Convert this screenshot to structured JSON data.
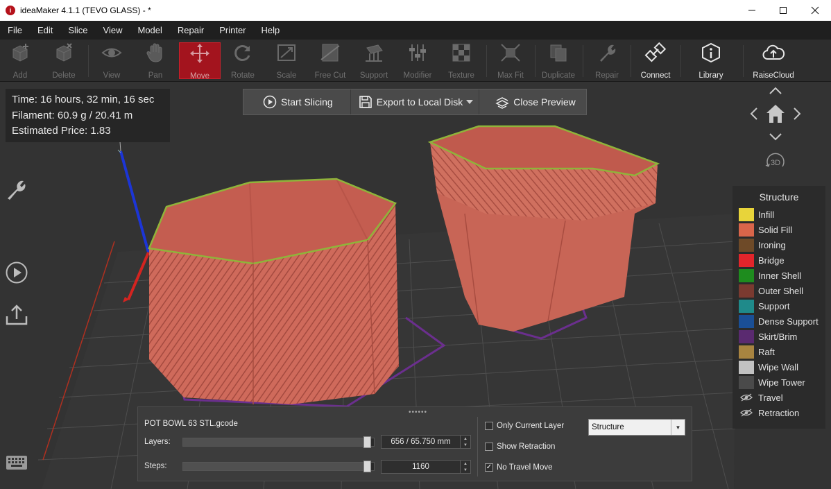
{
  "window": {
    "title": "ideaMaker 4.1.1 (TEVO GLASS) - *",
    "app_icon_glyph": "i"
  },
  "menu": [
    "File",
    "Edit",
    "Slice",
    "View",
    "Model",
    "Repair",
    "Printer",
    "Help"
  ],
  "toolbar": {
    "add": "Add",
    "delete": "Delete",
    "view": "View",
    "pan": "Pan",
    "move": "Move",
    "rotate": "Rotate",
    "scale": "Scale",
    "free_cut": "Free Cut",
    "support": "Support",
    "modifier": "Modifier",
    "texture": "Texture",
    "max_fit": "Max Fit",
    "duplicate": "Duplicate",
    "repair": "Repair",
    "connect": "Connect",
    "library": "Library",
    "raisecloud": "RaiseCloud",
    "active_tool": "move",
    "active_color": "#a3141e"
  },
  "info": {
    "time": "Time: 16 hours, 32 min, 16 sec",
    "filament": "Filament: 60.9 g / 20.41 m",
    "price": "Estimated Price: 1.83"
  },
  "actions": {
    "start_slicing": "Start Slicing",
    "export": "Export to Local Disk",
    "close_preview": "Close Preview"
  },
  "navpad": {
    "three_d": "3D"
  },
  "legend": {
    "title": "Structure",
    "items": [
      {
        "label": "Infill",
        "color": "#e8d43a"
      },
      {
        "label": "Solid Fill",
        "color": "#d9654a"
      },
      {
        "label": "Ironing",
        "color": "#6e4a28"
      },
      {
        "label": "Bridge",
        "color": "#e3252b"
      },
      {
        "label": "Inner Shell",
        "color": "#1e8c1e"
      },
      {
        "label": "Outer Shell",
        "color": "#7a3a30"
      },
      {
        "label": "Support",
        "color": "#1f8a8a"
      },
      {
        "label": "Dense Support",
        "color": "#1a4f96"
      },
      {
        "label": "Skirt/Brim",
        "color": "#5a2a70"
      },
      {
        "label": "Raft",
        "color": "#a88440"
      },
      {
        "label": "Wipe Wall",
        "color": "#c2c2c2"
      },
      {
        "label": "Wipe Tower",
        "color": "#4a4a4a"
      }
    ],
    "hidden_items": [
      {
        "label": "Travel",
        "icon": "eye-hidden-icon"
      },
      {
        "label": "Retraction",
        "icon": "eye-hidden-icon"
      }
    ]
  },
  "panel": {
    "filename": "POT BOWL 63 STL.gcode",
    "layers_label": "Layers:",
    "layers_value": "656 / 65.750 mm",
    "layers_fraction": 0.985,
    "steps_label": "Steps:",
    "steps_value": "1160",
    "steps_fraction": 0.985,
    "only_current_layer": {
      "label": "Only Current Layer",
      "checked": false
    },
    "show_retraction": {
      "label": "Show Retraction",
      "checked": false
    },
    "no_travel_move": {
      "label": "No Travel Move",
      "checked": true
    },
    "view_mode": "Structure"
  }
}
